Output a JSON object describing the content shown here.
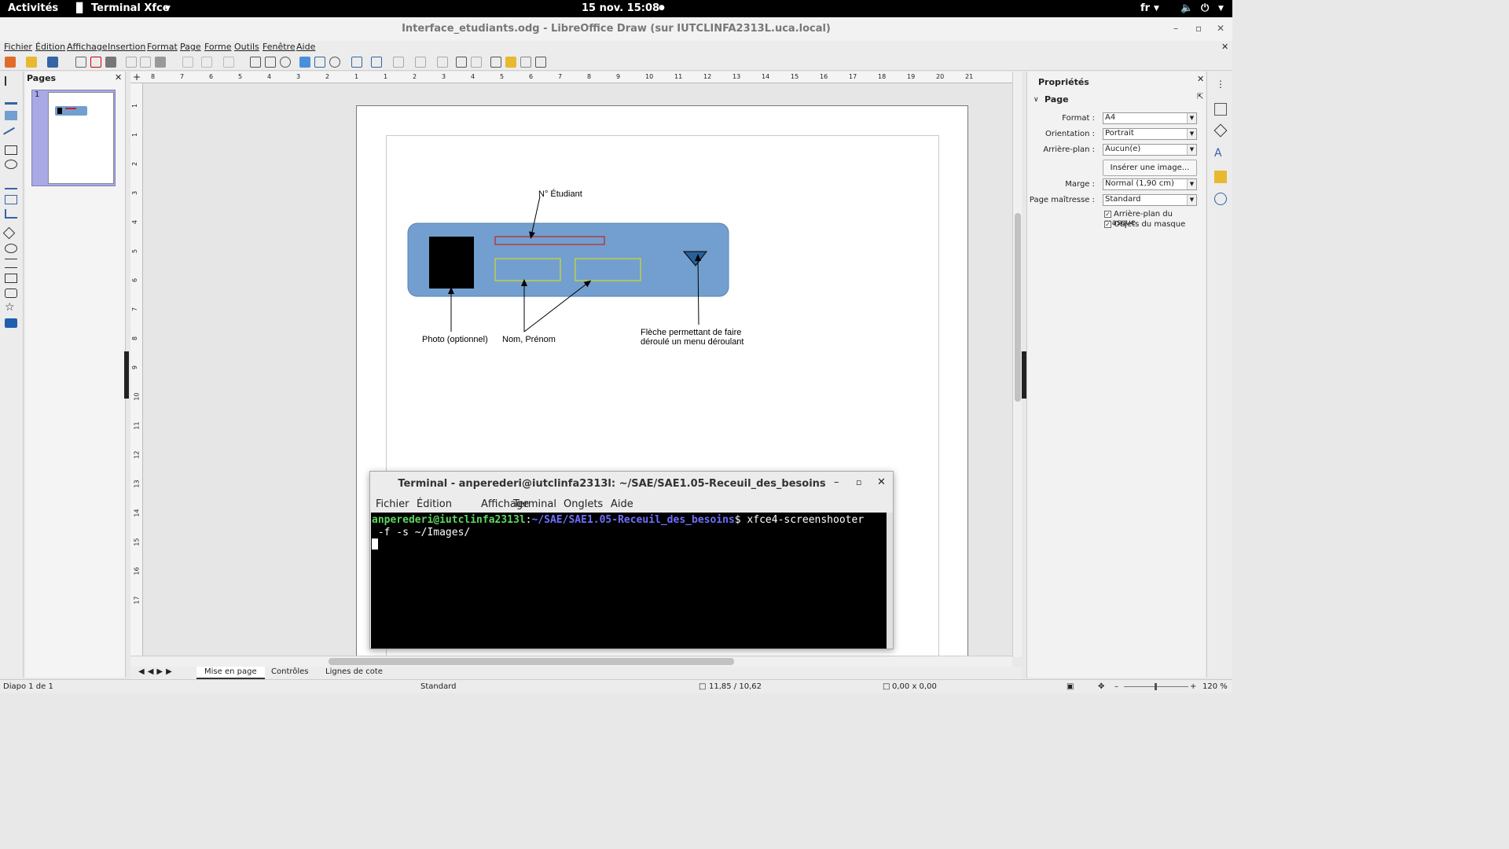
{
  "topbar": {
    "activities": "Activités",
    "app_menu": "Terminal Xfce",
    "clock": "15 nov.  15:08",
    "lang": "fr"
  },
  "window": {
    "title": "Interface_etudiants.odg - LibreOffice Draw (sur IUTCLINFA2313L.uca.local)"
  },
  "menubar": [
    "Fichier",
    "Édition",
    "Affichage",
    "Insertion",
    "Format",
    "Page",
    "Forme",
    "Outils",
    "Fenêtre",
    "Aide"
  ],
  "pages_panel": {
    "header": "Pages",
    "page_number": "1"
  },
  "hruler_ticks": [
    "8",
    "7",
    "6",
    "5",
    "4",
    "3",
    "2",
    "1",
    "1",
    "2",
    "3",
    "4",
    "5",
    "6",
    "7",
    "8",
    "9",
    "10",
    "11",
    "12",
    "13",
    "14",
    "15",
    "16",
    "17",
    "18",
    "19",
    "20",
    "21"
  ],
  "vruler_ticks": [
    "1",
    "1",
    "2",
    "3",
    "4",
    "5",
    "6",
    "7",
    "8",
    "9",
    "10",
    "11",
    "12",
    "13",
    "14",
    "15",
    "16",
    "17"
  ],
  "drawing": {
    "label_student_no": "N° Étudiant",
    "label_photo": "Photo (optionnel)",
    "label_name": "Nom, Prénom",
    "label_arrow_1": "Flèche permettant de faire",
    "label_arrow_2": "déroulé un menu déroulant",
    "colors": {
      "card": "#729fcf",
      "photo": "#000000",
      "red_field": "#c9211e",
      "yellow_field": "#e6e600",
      "triangle": "#2a6099"
    }
  },
  "terminal": {
    "title": "Terminal - anperederi@iutclinfa2313l: ~/SAE/SAE1.05-Receuil_des_besoins",
    "menu": [
      "Fichier",
      "Édition",
      "Affichage",
      "Terminal",
      "Onglets",
      "Aide"
    ],
    "prompt_user": "anperederi@iutclinfa2313l",
    "prompt_path": "~/SAE/SAE1.05-Receuil_des_besoins",
    "command_1": "$ xfce4-screenshooter",
    "command_2": " -f -s ~/Images/"
  },
  "sidebar": {
    "title": "Propriétés",
    "section": "Page",
    "format_label": "Format :",
    "format_value": "A4",
    "orientation_label": "Orientation :",
    "orientation_value": "Portrait",
    "background_label": "Arrière-plan :",
    "background_value": "Aucun(e)",
    "insert_image_button": "Insérer une image...",
    "margin_label": "Marge :",
    "margin_value": "Normal (1,90 cm)",
    "master_label": "Page maîtresse :",
    "master_value": "Standard",
    "check_master_bg": "Arrière-plan du masque",
    "check_master_objects": "Objets du masque"
  },
  "tabs": [
    "Mise en page",
    "Contrôles",
    "Lignes de cote"
  ],
  "status": {
    "slide": "Diapo 1 de 1",
    "layout": "Standard",
    "position": "11,85 / 10,62",
    "size": "0,00 x 0,00",
    "zoom": "120 %"
  }
}
